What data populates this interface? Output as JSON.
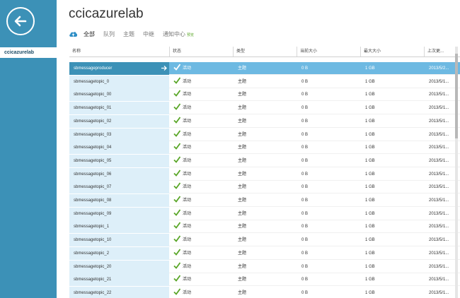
{
  "colors": {
    "sidebar": "#3c91b7",
    "selected_name": "#3c91b7",
    "selected_row": "#6db9e2",
    "name_bg": "#ddeff9",
    "check": "#5aa628"
  },
  "sidebar": {
    "back_icon": "back-arrow-icon",
    "item_label": "ccicazurelab"
  },
  "page": {
    "title": "ccicazurelab"
  },
  "tabs": [
    {
      "label": "全部"
    },
    {
      "label": "队列"
    },
    {
      "label": "主题"
    },
    {
      "label": "中继"
    },
    {
      "label": "通知中心"
    }
  ],
  "tab_preview_badge": "预览",
  "table": {
    "columns": [
      "名称",
      "状态",
      "类型",
      "当前大小",
      "最大大小",
      "上次更..."
    ],
    "rows": [
      {
        "name": "sbmessageproducer",
        "status": "活动",
        "type": "主题",
        "current": "0 B",
        "max": "1 GB",
        "last": "2013/5/2..."
      },
      {
        "name": "sbmessagetopic_0",
        "status": "活动",
        "type": "主题",
        "current": "0 B",
        "max": "1 GB",
        "last": "2013/5/1..."
      },
      {
        "name": "sbmessagetopic_00",
        "status": "活动",
        "type": "主题",
        "current": "0 B",
        "max": "1 GB",
        "last": "2013/5/1..."
      },
      {
        "name": "sbmessagetopic_01",
        "status": "活动",
        "type": "主题",
        "current": "0 B",
        "max": "1 GB",
        "last": "2013/5/1..."
      },
      {
        "name": "sbmessagetopic_02",
        "status": "活动",
        "type": "主题",
        "current": "0 B",
        "max": "1 GB",
        "last": "2013/5/1..."
      },
      {
        "name": "sbmessagetopic_03",
        "status": "活动",
        "type": "主题",
        "current": "0 B",
        "max": "1 GB",
        "last": "2013/5/1..."
      },
      {
        "name": "sbmessagetopic_04",
        "status": "活动",
        "type": "主题",
        "current": "0 B",
        "max": "1 GB",
        "last": "2013/5/1..."
      },
      {
        "name": "sbmessagetopic_05",
        "status": "活动",
        "type": "主题",
        "current": "0 B",
        "max": "1 GB",
        "last": "2013/5/1..."
      },
      {
        "name": "sbmessagetopic_06",
        "status": "活动",
        "type": "主题",
        "current": "0 B",
        "max": "1 GB",
        "last": "2013/5/1..."
      },
      {
        "name": "sbmessagetopic_07",
        "status": "活动",
        "type": "主题",
        "current": "0 B",
        "max": "1 GB",
        "last": "2013/5/1..."
      },
      {
        "name": "sbmessagetopic_08",
        "status": "活动",
        "type": "主题",
        "current": "0 B",
        "max": "1 GB",
        "last": "2013/5/1..."
      },
      {
        "name": "sbmessagetopic_09",
        "status": "活动",
        "type": "主题",
        "current": "0 B",
        "max": "1 GB",
        "last": "2013/5/1..."
      },
      {
        "name": "sbmessagetopic_1",
        "status": "活动",
        "type": "主题",
        "current": "0 B",
        "max": "1 GB",
        "last": "2013/5/1..."
      },
      {
        "name": "sbmessagetopic_10",
        "status": "活动",
        "type": "主题",
        "current": "0 B",
        "max": "1 GB",
        "last": "2013/5/1..."
      },
      {
        "name": "sbmessagetopic_2",
        "status": "活动",
        "type": "主题",
        "current": "0 B",
        "max": "1 GB",
        "last": "2013/5/1..."
      },
      {
        "name": "sbmessagetopic_20",
        "status": "活动",
        "type": "主题",
        "current": "0 B",
        "max": "1 GB",
        "last": "2013/5/1..."
      },
      {
        "name": "sbmessagetopic_21",
        "status": "活动",
        "type": "主题",
        "current": "0 B",
        "max": "1 GB",
        "last": "2013/5/1..."
      },
      {
        "name": "sbmessagetopic_22",
        "status": "活动",
        "type": "主题",
        "current": "0 B",
        "max": "1 GB",
        "last": "2013/5/1..."
      }
    ]
  }
}
